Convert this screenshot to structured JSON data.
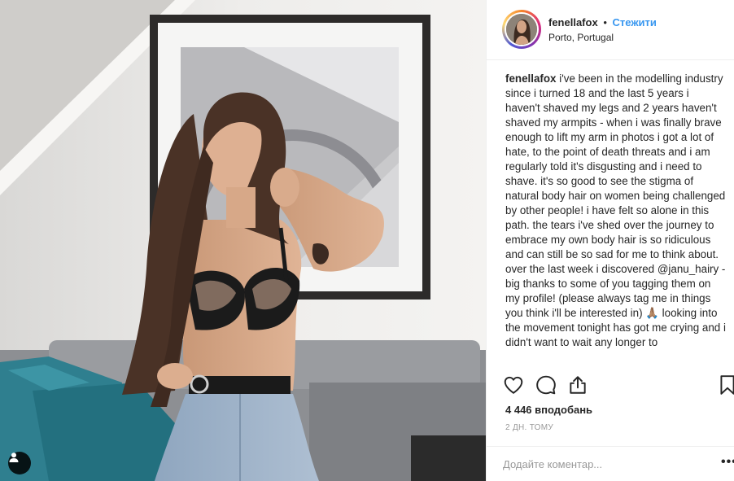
{
  "post": {
    "author": {
      "username": "fenellafox",
      "separator": "•",
      "follow_label": "Стежити",
      "location": "Porto, Portugal"
    },
    "caption": {
      "username": "fenellafox",
      "text": "i've been in the modelling industry since i turned 18 and the last 5 years i haven't shaved my legs and 2 years haven't shaved my armpits - when i was finally brave enough to lift my arm in photos i got a lot of hate, to the point of death threats and i am regularly told it's disgusting and i need to shave. it's so good to see the stigma of natural body hair on women being challenged by other people! i have felt so alone in this path. the tears i've shed over the journey to embrace my own body hair is so ridiculous and can still be so sad for me to think about. over the last week i discovered @janu_hairy - big thanks to some of you tagging them on my profile! (please always tag me in things you think i'll be interested in) 🙏🏽 looking into the movement tonight has got me crying and i didn't want to wait any longer to"
    },
    "actions": {
      "like_icon": "heart-icon",
      "comment_icon": "comment-bubble-icon",
      "share_icon": "share-icon",
      "save_icon": "bookmark-icon"
    },
    "likes_text": "4 446 вподобань",
    "timestamp": "2 ДН. ТОМУ",
    "comment": {
      "placeholder": "Додайте коментар...",
      "more_label": "•••"
    }
  },
  "media": {
    "tag_icon": "user-tag-icon"
  },
  "colors": {
    "follow_blue": "#3897f0",
    "muted_gray": "#999999",
    "text": "#262626",
    "border": "#efefef"
  }
}
